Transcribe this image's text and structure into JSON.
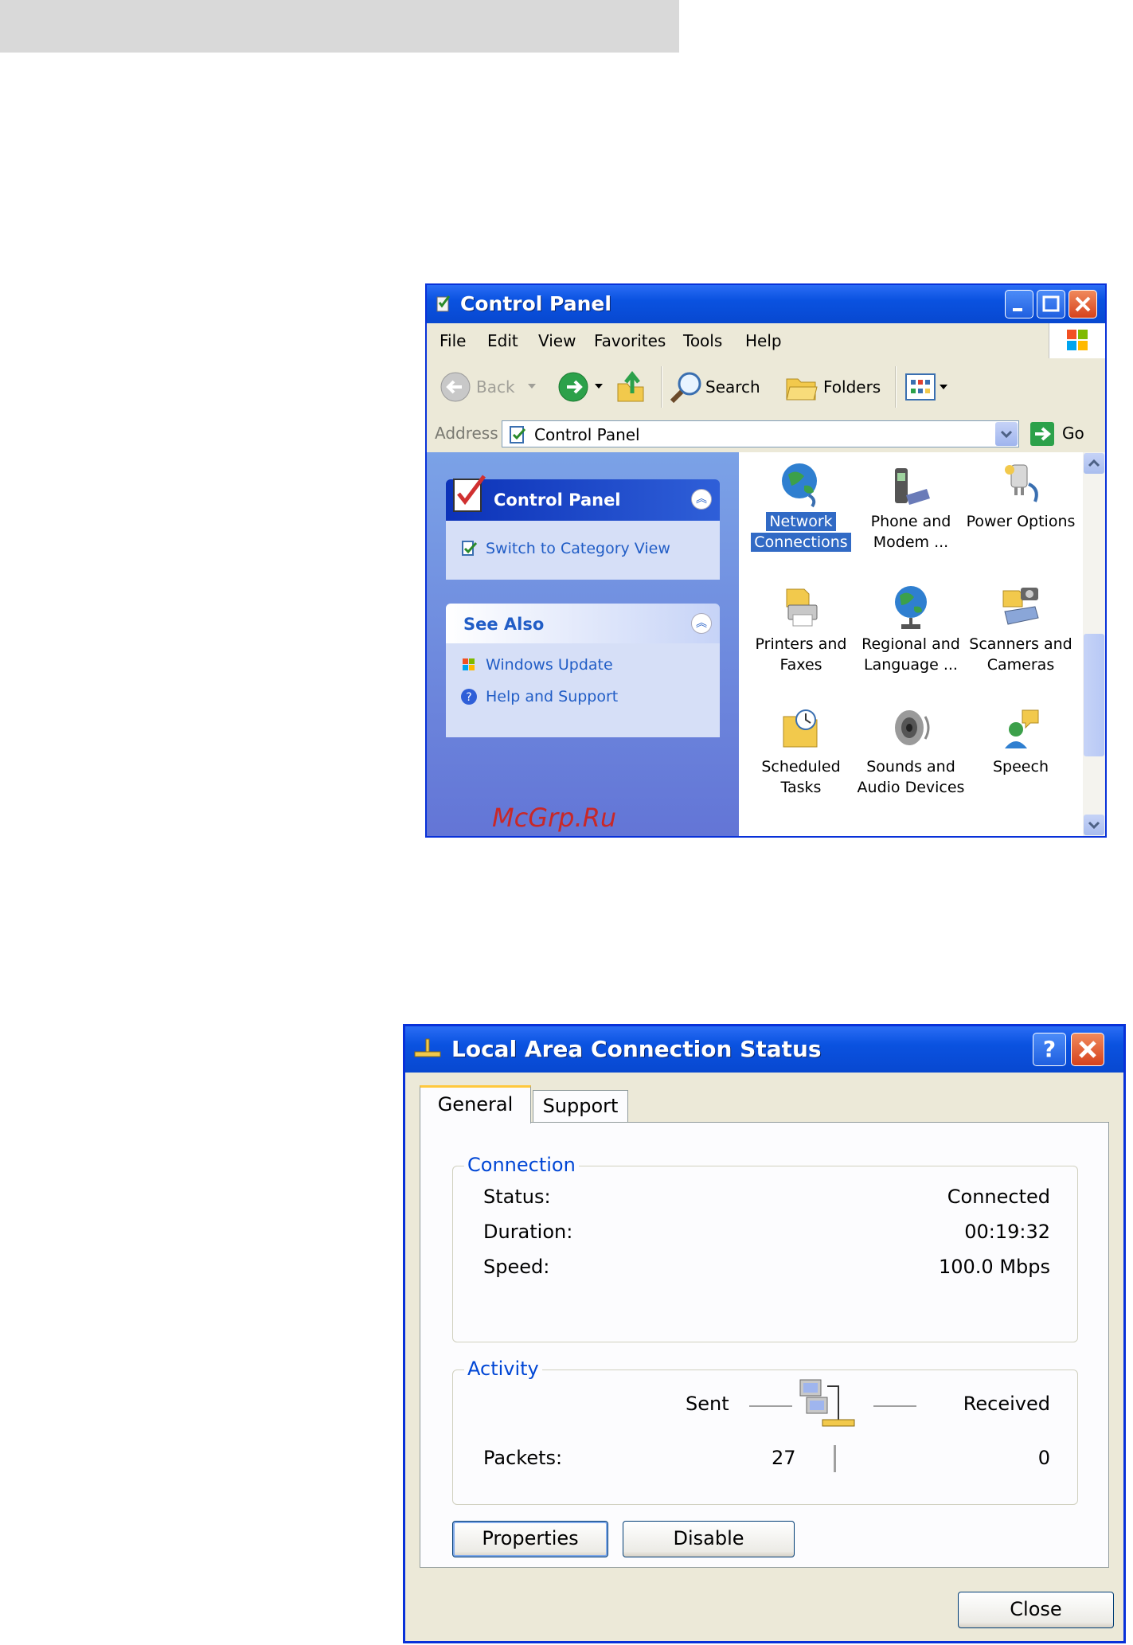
{
  "control_panel": {
    "title": "Control Panel",
    "menu": [
      "File",
      "Edit",
      "View",
      "Favorites",
      "Tools",
      "Help"
    ],
    "toolbar": {
      "back": "Back",
      "search": "Search",
      "folders": "Folders"
    },
    "address": {
      "label": "Address",
      "value": "Control Panel",
      "go": "Go"
    },
    "left_pane": {
      "box1": {
        "title": "Control Panel",
        "links": [
          "Switch to Category View"
        ]
      },
      "box2": {
        "title": "See Also",
        "links": [
          "Windows Update",
          "Help and Support"
        ]
      }
    },
    "items": [
      {
        "line1": "Network",
        "line2": "Connections",
        "icon": "network-connections-icon",
        "selected": true
      },
      {
        "line1": "Phone and",
        "line2": "Modem ...",
        "icon": "phone-modem-icon"
      },
      {
        "line1": "Power Options",
        "line2": "",
        "icon": "power-options-icon"
      },
      {
        "line1": "Printers and",
        "line2": "Faxes",
        "icon": "printer-icon"
      },
      {
        "line1": "Regional and",
        "line2": "Language ...",
        "icon": "globe-icon"
      },
      {
        "line1": "Scanners and",
        "line2": "Cameras",
        "icon": "scanner-camera-icon"
      },
      {
        "line1": "Scheduled",
        "line2": "Tasks",
        "icon": "scheduled-tasks-icon"
      },
      {
        "line1": "Sounds and",
        "line2": "Audio Devices",
        "icon": "speaker-icon"
      },
      {
        "line1": "Speech",
        "line2": "",
        "icon": "speech-icon"
      }
    ]
  },
  "watermark": "McGrp.Ru",
  "status_dialog": {
    "title": "Local Area Connection Status",
    "tabs": [
      "General",
      "Support"
    ],
    "connection": {
      "title": "Connection",
      "rows": [
        {
          "label": "Status:",
          "value": "Connected"
        },
        {
          "label": "Duration:",
          "value": "00:19:32"
        },
        {
          "label": "Speed:",
          "value": "100.0 Mbps"
        }
      ]
    },
    "activity": {
      "title": "Activity",
      "sent_label": "Sent",
      "received_label": "Received",
      "packets_label": "Packets:",
      "packets_sent": "27",
      "packets_received": "0"
    },
    "buttons": {
      "properties": "Properties",
      "disable": "Disable",
      "close": "Close"
    }
  },
  "colors": {
    "xp_title_blue": "#0a52e0",
    "link_blue": "#215dc6",
    "group_title_blue": "#0046d5",
    "watermark_red": "#c82828"
  }
}
